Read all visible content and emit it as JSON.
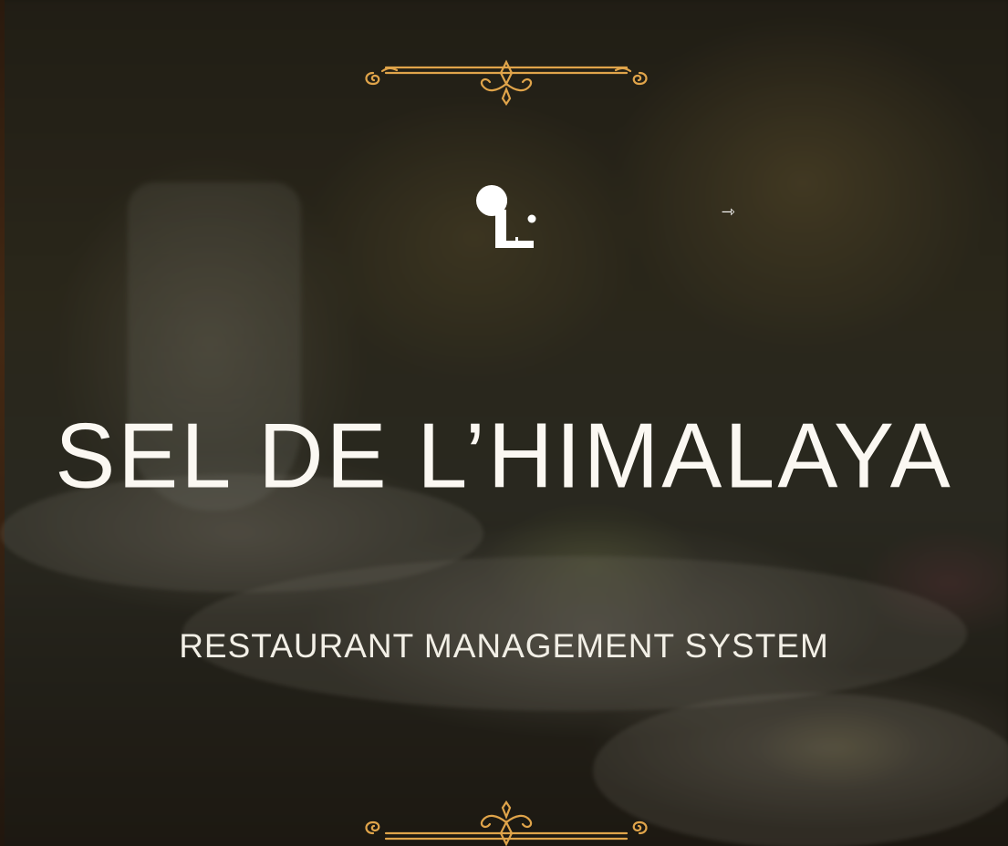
{
  "hero": {
    "title": "SEL DE L’HIMALAYA",
    "subtitle": "RESTAURANT MANAGEMENT SYSTEM"
  },
  "logo": {
    "icon": "monogram-logo"
  },
  "nav": {
    "enter_icon": "arrow-right-icon",
    "enter_glyph": "⇾"
  },
  "colors": {
    "accent_gold": "#e0a44a",
    "text": "#fbf8f2"
  }
}
